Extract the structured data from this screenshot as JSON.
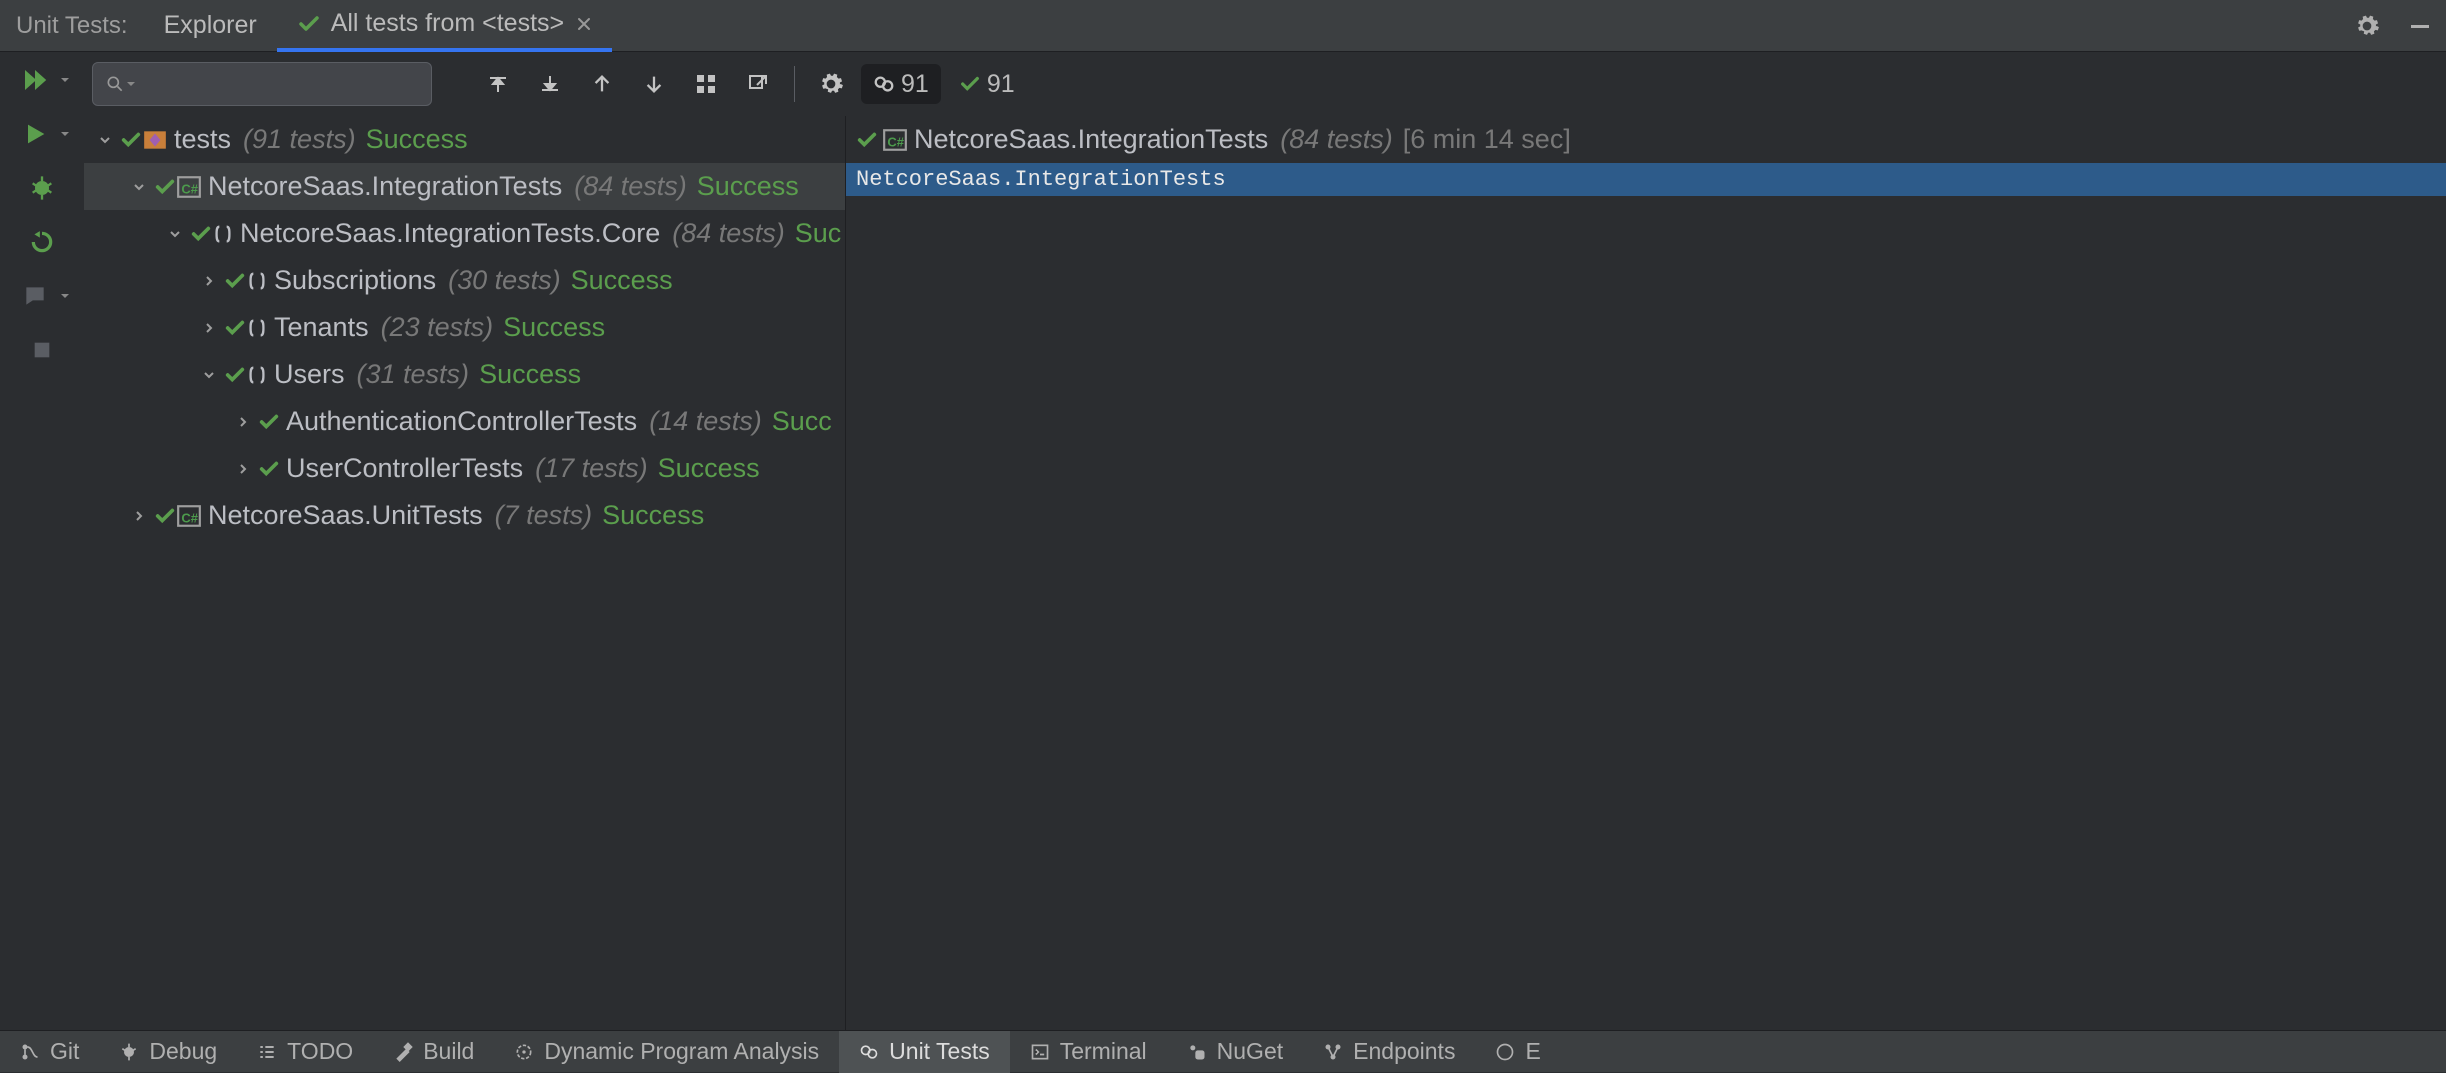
{
  "titlebar": {
    "title": "Unit Tests:",
    "tabs": {
      "explorer": "Explorer",
      "active": "All tests from <tests>"
    }
  },
  "search": {
    "placeholder": ""
  },
  "counts": {
    "failed_label": "91",
    "passed_label": "91"
  },
  "tree": {
    "root": {
      "name": "tests",
      "count": "(91 tests)",
      "status": "Success"
    },
    "n1": {
      "name": "NetcoreSaas.IntegrationTests",
      "count": "(84 tests)",
      "status": "Success"
    },
    "n2": {
      "name": "NetcoreSaas.IntegrationTests.Core",
      "count": "(84 tests)",
      "status": "Suc"
    },
    "n3": {
      "name": "Subscriptions",
      "count": "(30 tests)",
      "status": "Success"
    },
    "n4": {
      "name": "Tenants",
      "count": "(23 tests)",
      "status": "Success"
    },
    "n5": {
      "name": "Users",
      "count": "(31 tests)",
      "status": "Success"
    },
    "n6": {
      "name": "AuthenticationControllerTests",
      "count": "(14 tests)",
      "status": "Succ"
    },
    "n7": {
      "name": "UserControllerTests",
      "count": "(17 tests)",
      "status": "Success"
    },
    "n8": {
      "name": "NetcoreSaas.UnitTests",
      "count": "(7 tests)",
      "status": "Success"
    }
  },
  "result": {
    "name": "NetcoreSaas.IntegrationTests",
    "count": "(84 tests)",
    "time": "[6 min 14 sec]",
    "output_line": "NetcoreSaas.IntegrationTests"
  },
  "bottombar": {
    "git": "Git",
    "debug": "Debug",
    "todo": "TODO",
    "build": "Build",
    "dpa": "Dynamic Program Analysis",
    "ut": "Unit Tests",
    "terminal": "Terminal",
    "nuget": "NuGet",
    "endpoints": "Endpoints",
    "extra": "E"
  }
}
